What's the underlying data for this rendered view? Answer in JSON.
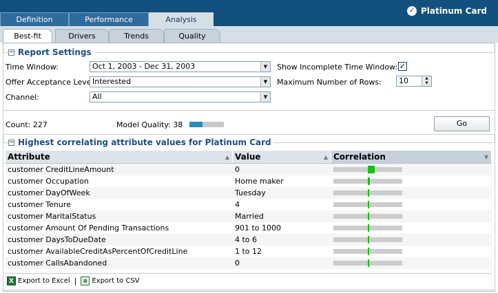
{
  "header": {
    "main_tabs": [
      {
        "label": "Definition"
      },
      {
        "label": "Performance"
      },
      {
        "label": "Analysis"
      }
    ],
    "brand": "Platinum Card",
    "brand_icon": "check-circle-icon"
  },
  "sub_tabs": [
    {
      "label": "Best-fit"
    },
    {
      "label": "Drivers"
    },
    {
      "label": "Trends"
    },
    {
      "label": "Quality"
    }
  ],
  "report_settings": {
    "title": "Report Settings",
    "time_window_label": "Time Window:",
    "time_window_value": "Oct 1, 2003 - Dec 31, 2003",
    "offer_label": "Offer Acceptance Level:",
    "offer_value": "Interested",
    "channel_label": "Channel:",
    "channel_value": "All",
    "incomplete_label": "Show Incomplete Time Window:",
    "incomplete_checked": true,
    "incomplete_mark": "✓",
    "max_rows_label": "Maximum Number of Rows:",
    "max_rows_value": "10",
    "count_text": "Count: 227",
    "quality_text": "Model Quality: 38",
    "quality_fraction": 0.38,
    "go_label": "Go"
  },
  "results": {
    "title": "Highest correlating attribute values for Platinum Card",
    "columns": [
      "Attribute",
      "Value",
      "Correlation"
    ],
    "rows": [
      {
        "attribute": "customer CreditLineAmount",
        "value": "0",
        "corr": 0.2
      },
      {
        "attribute": "customer Occupation",
        "value": "Home maker",
        "corr": 0.06
      },
      {
        "attribute": "customer DayOfWeek",
        "value": "Tuesday",
        "corr": 0.04
      },
      {
        "attribute": "customer Tenure",
        "value": "4",
        "corr": 0.04
      },
      {
        "attribute": "customer MaritalStatus",
        "value": "Married",
        "corr": 0.04
      },
      {
        "attribute": "customer Amount Of Pending Transactions",
        "value": "901 to 1000",
        "corr": 0.04
      },
      {
        "attribute": "customer DaysToDueDate",
        "value": "4 to 6",
        "corr": 0.04
      },
      {
        "attribute": "customer AvailableCreditAsPercentOfCreditLine",
        "value": "1 to 12",
        "corr": 0.03
      },
      {
        "attribute": "customer CallsAbandoned",
        "value": "0",
        "corr": 0.02
      }
    ],
    "export_excel": "Export to Excel",
    "export_csv": "Export to CSV",
    "separator": "|"
  },
  "colors": {
    "header_bg": "#12507e",
    "correlation_bar": "#11c211",
    "quality_fill": "#2e8ab8"
  }
}
